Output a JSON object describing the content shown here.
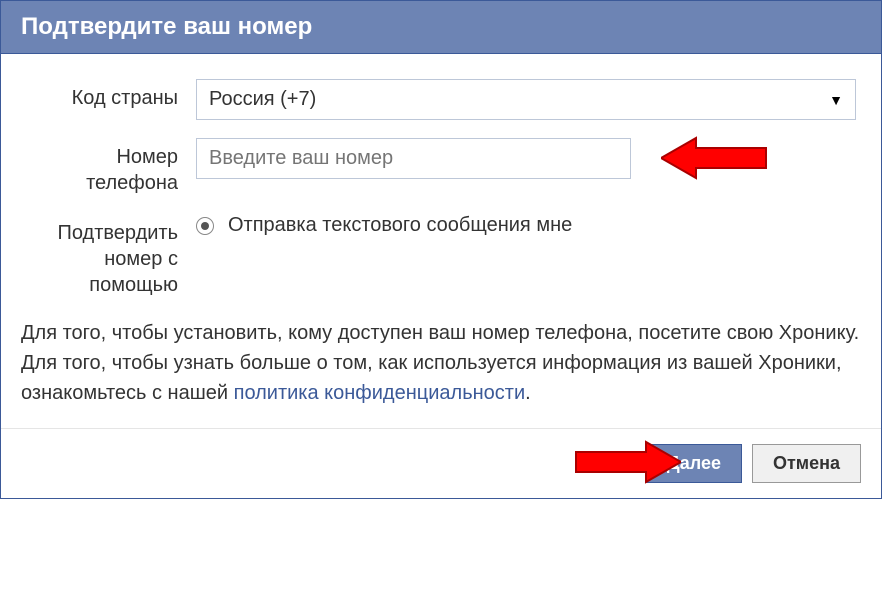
{
  "dialog": {
    "title": "Подтвердите ваш номер"
  },
  "form": {
    "country": {
      "label": "Код страны",
      "selected": "Россия (+7)"
    },
    "phone": {
      "label": "Номер телефона",
      "placeholder": "Введите ваш номер"
    },
    "confirm": {
      "label": "Подтвердить номер с помощью",
      "option": "Отправка текстового сообщения мне"
    }
  },
  "description": {
    "part1": "Для того, чтобы установить, кому доступен ваш номер телефона, посетите свою Хронику. Для того, чтобы узнать больше о том, как используется информация из вашей Хроники, ознакомьтесь с нашей ",
    "link": "политика конфиденциальности",
    "part2": "."
  },
  "buttons": {
    "next": "Далее",
    "cancel": "Отмена"
  },
  "annotations": {
    "arrow_color": "#ff0000"
  }
}
